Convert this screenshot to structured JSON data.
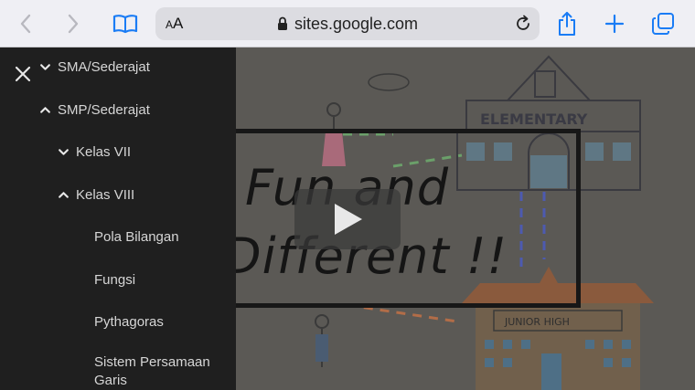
{
  "browser": {
    "text_size_label_small": "A",
    "text_size_label_large": "A",
    "url": "sites.google.com",
    "icons": {
      "back": "chevron-left-icon",
      "forward": "chevron-right-icon",
      "bookmarks": "book-icon",
      "lock": "lock-icon",
      "reload": "reload-icon",
      "share": "share-icon",
      "new_tab": "plus-icon",
      "tabs": "tabs-icon"
    }
  },
  "drawer": {
    "close_icon": "close-icon",
    "items": [
      {
        "label": "SMA/Sederajat",
        "chevron": "down"
      },
      {
        "label": "SMP/Sederajat",
        "chevron": "up"
      },
      {
        "label": "Kelas VII",
        "chevron": "down"
      },
      {
        "label": "Kelas VIII",
        "chevron": "up"
      },
      {
        "label": "Pola Bilangan"
      },
      {
        "label": "Fungsi"
      },
      {
        "label": "Pythagoras"
      },
      {
        "label_line1": "Sistem Persamaan",
        "label_line2": "Garis"
      }
    ]
  },
  "video": {
    "title_line1": "Fun and",
    "title_line2": "Different !!",
    "sign_top": "ELEMENTARY",
    "sign_bottom": "JUNIOR HIGH",
    "play_icon": "play-icon"
  }
}
